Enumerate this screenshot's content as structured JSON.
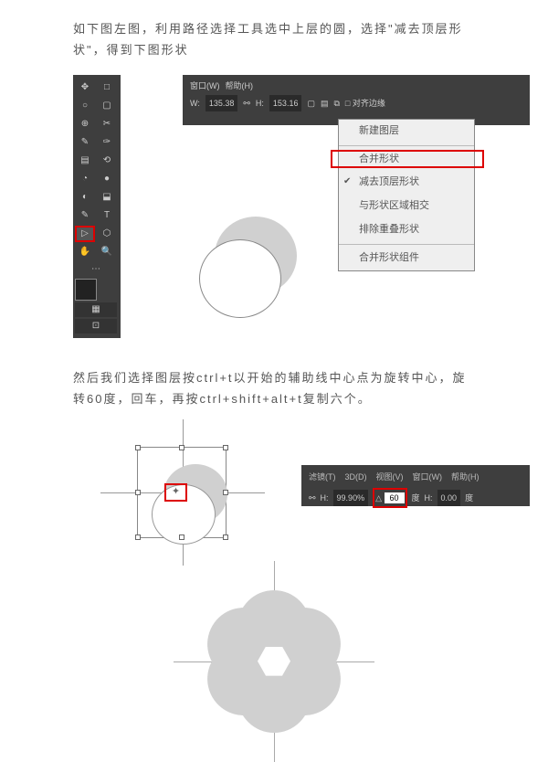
{
  "instructions": {
    "p1": "如下图左图，利用路径选择工具选中上层的圆，选择\"减去顶层形状\"，得到下图形状",
    "p2": "然后我们选择图层按ctrl+t以开始的辅助线中心点为旋转中心，旋转60度，回车，再按ctrl+shift+alt+t复制六个。"
  },
  "toolbox": {
    "tools": [
      "✥",
      "□",
      "○",
      "▢",
      "⊕",
      "✂",
      "✎",
      "✑",
      "▤",
      "⟲",
      "◔",
      "●",
      "◐",
      "⬓",
      "✎",
      "T",
      "▷",
      "⬡",
      "✋",
      "🔍"
    ]
  },
  "optionsbar": {
    "menu_window": "窗口(W)",
    "menu_help": "帮助(H)",
    "w_label": "W:",
    "w_value": "135.38",
    "h_label": "H:",
    "h_value": "153.16",
    "align_label": "□ 对齐边缘"
  },
  "contextmenu": {
    "items": [
      "新建图层",
      "合并形状",
      "减去顶层形状",
      "与形状区域相交",
      "排除重叠形状",
      "合并形状组件"
    ]
  },
  "pivot": "✦",
  "menubar": {
    "filter": "滤镜(T)",
    "threed": "3D(D)",
    "view": "视图(V)",
    "window": "窗口(W)",
    "help": "帮助(H)"
  },
  "anglebar": {
    "h_label": "H:",
    "h_value": "99.90%",
    "angle_symbol": "△",
    "angle_value": "60",
    "angle_unit": "度",
    "skew_h": "H:",
    "skew_h_val": "0.00",
    "skew_unit": "度"
  }
}
